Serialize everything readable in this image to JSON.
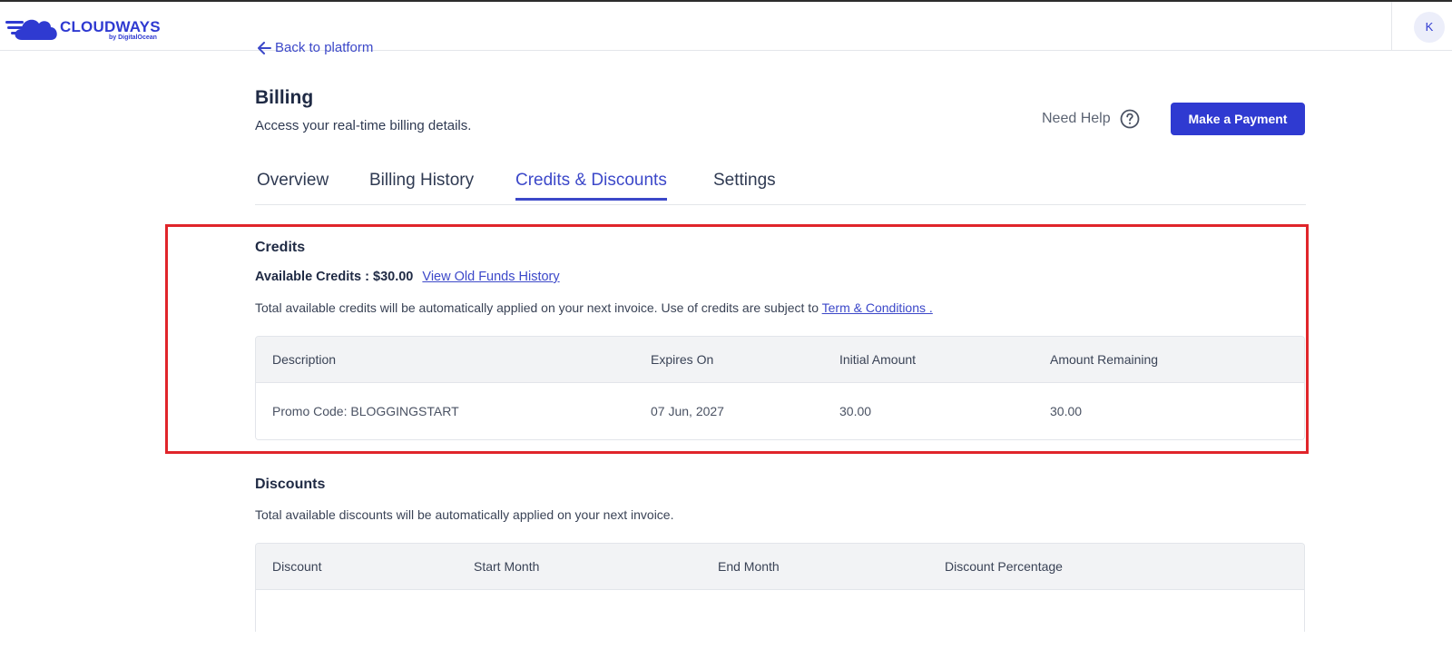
{
  "header": {
    "logo_text": "CLOUDWAYS",
    "logo_sub": "by DigitalOcean",
    "avatar_initial": "K"
  },
  "nav": {
    "back_label": "Back to platform"
  },
  "page": {
    "title": "Billing",
    "subtitle": "Access your real-time billing details.",
    "need_help": "Need Help",
    "pay_button": "Make a Payment"
  },
  "tabs": [
    {
      "label": "Overview",
      "active": false
    },
    {
      "label": "Billing History",
      "active": false
    },
    {
      "label": "Credits & Discounts",
      "active": true
    },
    {
      "label": "Settings",
      "active": false
    }
  ],
  "credits": {
    "title": "Credits",
    "available_label": "Available Credits :",
    "available_value": "$30.00",
    "history_link": "View Old Funds History",
    "note": "Total available credits will be automatically applied on your next invoice. Use of credits are subject to",
    "terms_link": "Term & Conditions .",
    "columns": [
      "Description",
      "Expires On",
      "Initial Amount",
      "Amount Remaining"
    ],
    "rows": [
      [
        "Promo Code: BLOGGINGSTART",
        "07 Jun, 2027",
        "30.00",
        "30.00"
      ]
    ]
  },
  "discounts": {
    "title": "Discounts",
    "note": "Total available discounts will be automatically applied on your next invoice.",
    "columns": [
      "Discount",
      "Start Month",
      "End Month",
      "Discount Percentage"
    ]
  },
  "colors": {
    "accent": "#2f3ad1",
    "highlight": "#e0252a"
  }
}
